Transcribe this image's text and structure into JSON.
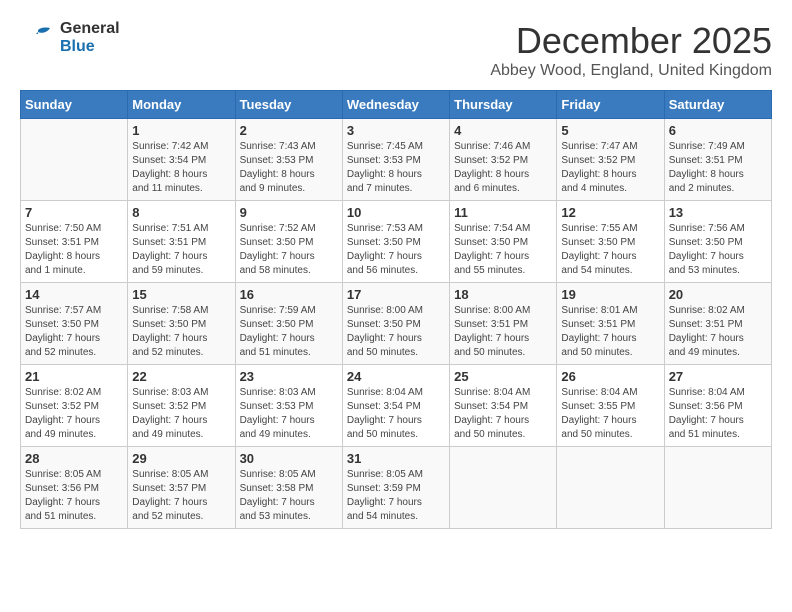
{
  "logo": {
    "line1": "General",
    "line2": "Blue"
  },
  "title": "December 2025",
  "location": "Abbey Wood, England, United Kingdom",
  "days_of_week": [
    "Sunday",
    "Monday",
    "Tuesday",
    "Wednesday",
    "Thursday",
    "Friday",
    "Saturday"
  ],
  "weeks": [
    [
      {
        "day": "",
        "info": ""
      },
      {
        "day": "1",
        "info": "Sunrise: 7:42 AM\nSunset: 3:54 PM\nDaylight: 8 hours\nand 11 minutes."
      },
      {
        "day": "2",
        "info": "Sunrise: 7:43 AM\nSunset: 3:53 PM\nDaylight: 8 hours\nand 9 minutes."
      },
      {
        "day": "3",
        "info": "Sunrise: 7:45 AM\nSunset: 3:53 PM\nDaylight: 8 hours\nand 7 minutes."
      },
      {
        "day": "4",
        "info": "Sunrise: 7:46 AM\nSunset: 3:52 PM\nDaylight: 8 hours\nand 6 minutes."
      },
      {
        "day": "5",
        "info": "Sunrise: 7:47 AM\nSunset: 3:52 PM\nDaylight: 8 hours\nand 4 minutes."
      },
      {
        "day": "6",
        "info": "Sunrise: 7:49 AM\nSunset: 3:51 PM\nDaylight: 8 hours\nand 2 minutes."
      }
    ],
    [
      {
        "day": "7",
        "info": "Sunrise: 7:50 AM\nSunset: 3:51 PM\nDaylight: 8 hours\nand 1 minute."
      },
      {
        "day": "8",
        "info": "Sunrise: 7:51 AM\nSunset: 3:51 PM\nDaylight: 7 hours\nand 59 minutes."
      },
      {
        "day": "9",
        "info": "Sunrise: 7:52 AM\nSunset: 3:50 PM\nDaylight: 7 hours\nand 58 minutes."
      },
      {
        "day": "10",
        "info": "Sunrise: 7:53 AM\nSunset: 3:50 PM\nDaylight: 7 hours\nand 56 minutes."
      },
      {
        "day": "11",
        "info": "Sunrise: 7:54 AM\nSunset: 3:50 PM\nDaylight: 7 hours\nand 55 minutes."
      },
      {
        "day": "12",
        "info": "Sunrise: 7:55 AM\nSunset: 3:50 PM\nDaylight: 7 hours\nand 54 minutes."
      },
      {
        "day": "13",
        "info": "Sunrise: 7:56 AM\nSunset: 3:50 PM\nDaylight: 7 hours\nand 53 minutes."
      }
    ],
    [
      {
        "day": "14",
        "info": "Sunrise: 7:57 AM\nSunset: 3:50 PM\nDaylight: 7 hours\nand 52 minutes."
      },
      {
        "day": "15",
        "info": "Sunrise: 7:58 AM\nSunset: 3:50 PM\nDaylight: 7 hours\nand 52 minutes."
      },
      {
        "day": "16",
        "info": "Sunrise: 7:59 AM\nSunset: 3:50 PM\nDaylight: 7 hours\nand 51 minutes."
      },
      {
        "day": "17",
        "info": "Sunrise: 8:00 AM\nSunset: 3:50 PM\nDaylight: 7 hours\nand 50 minutes."
      },
      {
        "day": "18",
        "info": "Sunrise: 8:00 AM\nSunset: 3:51 PM\nDaylight: 7 hours\nand 50 minutes."
      },
      {
        "day": "19",
        "info": "Sunrise: 8:01 AM\nSunset: 3:51 PM\nDaylight: 7 hours\nand 50 minutes."
      },
      {
        "day": "20",
        "info": "Sunrise: 8:02 AM\nSunset: 3:51 PM\nDaylight: 7 hours\nand 49 minutes."
      }
    ],
    [
      {
        "day": "21",
        "info": "Sunrise: 8:02 AM\nSunset: 3:52 PM\nDaylight: 7 hours\nand 49 minutes."
      },
      {
        "day": "22",
        "info": "Sunrise: 8:03 AM\nSunset: 3:52 PM\nDaylight: 7 hours\nand 49 minutes."
      },
      {
        "day": "23",
        "info": "Sunrise: 8:03 AM\nSunset: 3:53 PM\nDaylight: 7 hours\nand 49 minutes."
      },
      {
        "day": "24",
        "info": "Sunrise: 8:04 AM\nSunset: 3:54 PM\nDaylight: 7 hours\nand 50 minutes."
      },
      {
        "day": "25",
        "info": "Sunrise: 8:04 AM\nSunset: 3:54 PM\nDaylight: 7 hours\nand 50 minutes."
      },
      {
        "day": "26",
        "info": "Sunrise: 8:04 AM\nSunset: 3:55 PM\nDaylight: 7 hours\nand 50 minutes."
      },
      {
        "day": "27",
        "info": "Sunrise: 8:04 AM\nSunset: 3:56 PM\nDaylight: 7 hours\nand 51 minutes."
      }
    ],
    [
      {
        "day": "28",
        "info": "Sunrise: 8:05 AM\nSunset: 3:56 PM\nDaylight: 7 hours\nand 51 minutes."
      },
      {
        "day": "29",
        "info": "Sunrise: 8:05 AM\nSunset: 3:57 PM\nDaylight: 7 hours\nand 52 minutes."
      },
      {
        "day": "30",
        "info": "Sunrise: 8:05 AM\nSunset: 3:58 PM\nDaylight: 7 hours\nand 53 minutes."
      },
      {
        "day": "31",
        "info": "Sunrise: 8:05 AM\nSunset: 3:59 PM\nDaylight: 7 hours\nand 54 minutes."
      },
      {
        "day": "",
        "info": ""
      },
      {
        "day": "",
        "info": ""
      },
      {
        "day": "",
        "info": ""
      }
    ]
  ]
}
